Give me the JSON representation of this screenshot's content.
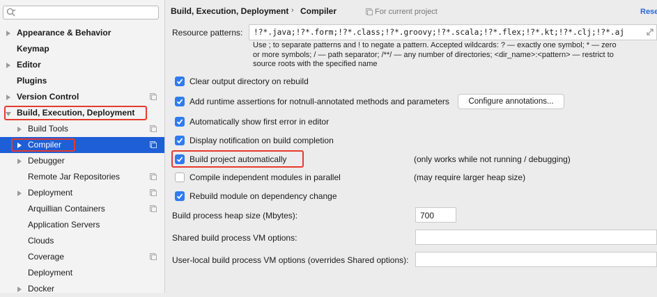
{
  "sidebar": {
    "search": {
      "placeholder": ""
    },
    "items": [
      {
        "label": "Appearance & Behavior"
      },
      {
        "label": "Keymap"
      },
      {
        "label": "Editor"
      },
      {
        "label": "Plugins"
      },
      {
        "label": "Version Control"
      },
      {
        "label": "Build, Execution, Deployment"
      },
      {
        "label": "Build Tools"
      },
      {
        "label": "Compiler"
      },
      {
        "label": "Debugger"
      },
      {
        "label": "Remote Jar Repositories"
      },
      {
        "label": "Deployment"
      },
      {
        "label": "Arquillian Containers"
      },
      {
        "label": "Application Servers"
      },
      {
        "label": "Clouds"
      },
      {
        "label": "Coverage"
      },
      {
        "label": "Deployment"
      },
      {
        "label": "Docker"
      }
    ]
  },
  "header": {
    "breadcrumb_parent": "Build, Execution, Deployment",
    "breadcrumb_separator": "›",
    "breadcrumb_current": "Compiler",
    "scope": "For current project",
    "reset": "Rese"
  },
  "resource_patterns": {
    "label": "Resource patterns:",
    "value": "!?*.java;!?*.form;!?*.class;!?*.groovy;!?*.scala;!?*.flex;!?*.kt;!?*.clj;!?*.aj",
    "hint_line1": "Use ; to separate patterns and ! to negate a pattern. Accepted wildcards: ? — exactly one symbol; * — zero",
    "hint_line2": "or more symbols; / — path separator; /**/ — any number of directories; <dir_name>:<pattern> — restrict to",
    "hint_line3": "source roots with the specified name"
  },
  "options": [
    {
      "label": "Clear output directory on rebuild",
      "checked": true
    },
    {
      "label": "Add runtime assertions for notnull-annotated methods and parameters",
      "checked": true
    },
    {
      "label": "Automatically show first error in editor",
      "checked": true
    },
    {
      "label": "Display notification on build completion",
      "checked": true
    },
    {
      "label": "Build project automatically",
      "checked": true,
      "note": "(only works while not running / debugging)"
    },
    {
      "label": "Compile independent modules in parallel",
      "checked": false,
      "note": "(may require larger heap size)"
    },
    {
      "label": "Rebuild module on dependency change",
      "checked": true
    }
  ],
  "configure_annotations_button": "Configure annotations...",
  "heap_size": {
    "label": "Build process heap size (Mbytes):",
    "value": "700"
  },
  "shared_vm_options": {
    "label": "Shared build process VM options:",
    "value": ""
  },
  "user_vm_options": {
    "label": "User-local build process VM options (overrides Shared options):",
    "value": ""
  },
  "colors": {
    "selection": "#1f5fd6",
    "checkbox": "#2f7bf0",
    "highlight": "#e63a2e",
    "link": "#2a6ad6"
  }
}
